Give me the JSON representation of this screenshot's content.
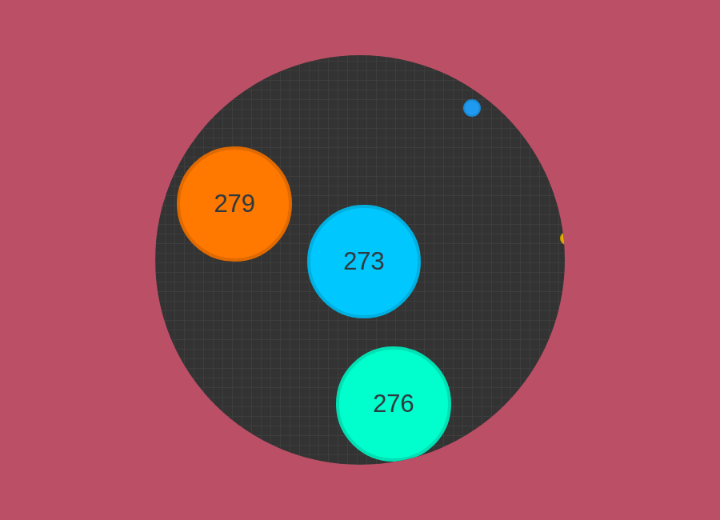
{
  "game": {
    "cells": [
      {
        "label": "279",
        "color": "#ff7800"
      },
      {
        "label": "273",
        "color": "#00c8ff"
      },
      {
        "label": "276",
        "color": "#00ffcc"
      }
    ],
    "pellets": [
      {
        "color": "#1e9bf0"
      },
      {
        "color": "#e8b400"
      }
    ]
  }
}
